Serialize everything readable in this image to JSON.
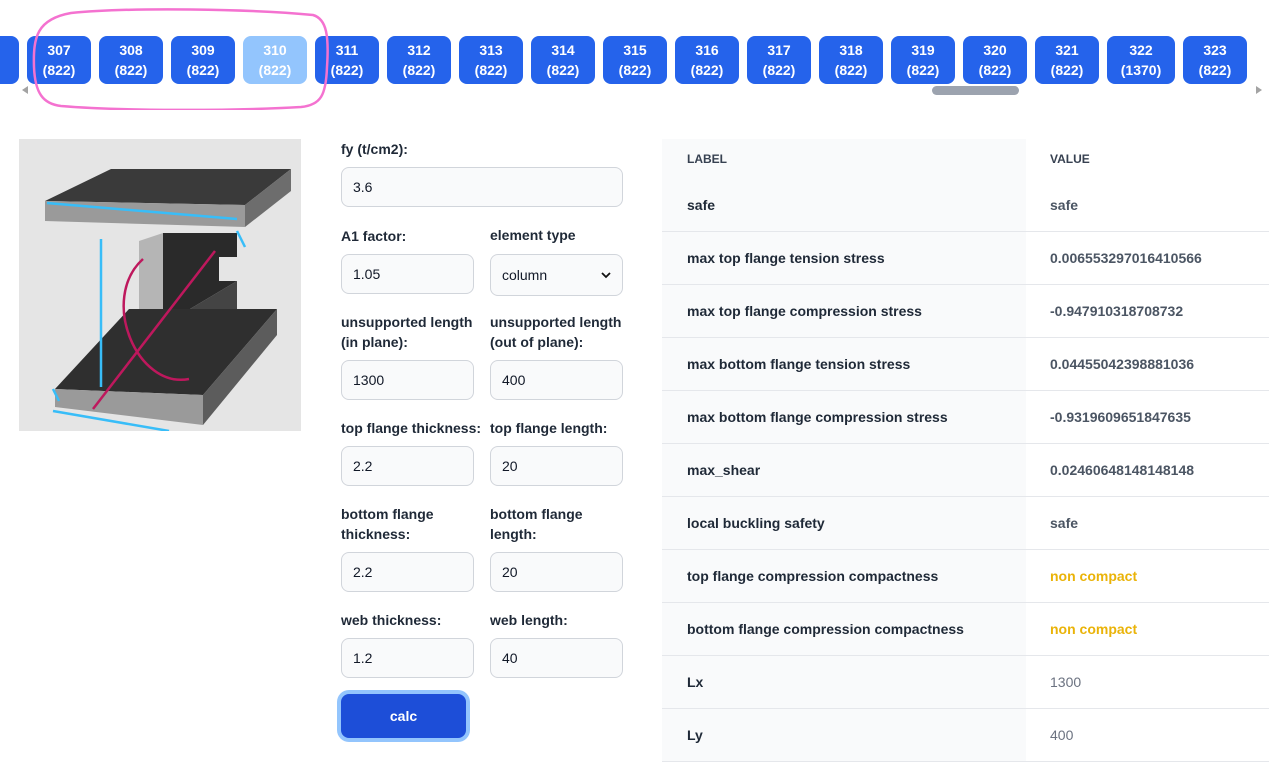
{
  "tabs": [
    {
      "number": "307",
      "count": "(822)"
    },
    {
      "number": "308",
      "count": "(822)"
    },
    {
      "number": "309",
      "count": "(822)"
    },
    {
      "number": "310",
      "count": "(822)"
    },
    {
      "number": "311",
      "count": "(822)"
    },
    {
      "number": "312",
      "count": "(822)"
    },
    {
      "number": "313",
      "count": "(822)"
    },
    {
      "number": "314",
      "count": "(822)"
    },
    {
      "number": "315",
      "count": "(822)"
    },
    {
      "number": "316",
      "count": "(822)"
    },
    {
      "number": "317",
      "count": "(822)"
    },
    {
      "number": "318",
      "count": "(822)"
    },
    {
      "number": "319",
      "count": "(822)"
    },
    {
      "number": "320",
      "count": "(822)"
    },
    {
      "number": "321",
      "count": "(822)"
    },
    {
      "number": "322",
      "count": "(1370)"
    },
    {
      "number": "323",
      "count": "(822)"
    }
  ],
  "active_tab": "310",
  "colors": {
    "tab": "#2563eb",
    "tab_active": "#93c5fd",
    "warning": "#eab308",
    "annotation": "#f472d0"
  },
  "form": {
    "fy_label": "fy (t/cm2):",
    "fy_value": "3.6",
    "a1_label": "A1 factor:",
    "a1_value": "1.05",
    "element_type_label": "element type",
    "element_type_value": "column",
    "unsupported_in_label": "unsupported length (in plane):",
    "unsupported_in_value": "1300",
    "unsupported_out_label": "unsupported length (out of plane):",
    "unsupported_out_value": "400",
    "top_thick_label": "top flange thickness:",
    "top_thick_value": "2.2",
    "top_len_label": "top flange length:",
    "top_len_value": "20",
    "bot_thick_label": "bottom flange thickness:",
    "bot_thick_value": "2.2",
    "bot_len_label": "bottom flange length:",
    "bot_len_value": "20",
    "web_thick_label": "web thickness:",
    "web_thick_value": "1.2",
    "web_len_label": "web length:",
    "web_len_value": "40",
    "calc_label": "calc"
  },
  "table": {
    "header": {
      "label": "LABEL",
      "value": "VALUE"
    },
    "rows": [
      {
        "label": "safe",
        "value": "safe"
      },
      {
        "label": "max top flange tension stress",
        "value": "0.006553297016410566"
      },
      {
        "label": "max top flange compression stress",
        "value": "-0.947910318708732"
      },
      {
        "label": "max bottom flange tension stress",
        "value": "0.04455042398881036"
      },
      {
        "label": "max bottom flange compression stress",
        "value": "-0.9319609651847635"
      },
      {
        "label": "max_shear",
        "value": "0.02460648148148148"
      },
      {
        "label": "local buckling safety",
        "value": "safe"
      },
      {
        "label": "top flange compression compactness",
        "value": "non compact"
      },
      {
        "label": "bottom flange compression compactness",
        "value": "non compact"
      },
      {
        "label": "Lx",
        "value": "1300"
      },
      {
        "label": "Ly",
        "value": "400"
      }
    ]
  }
}
